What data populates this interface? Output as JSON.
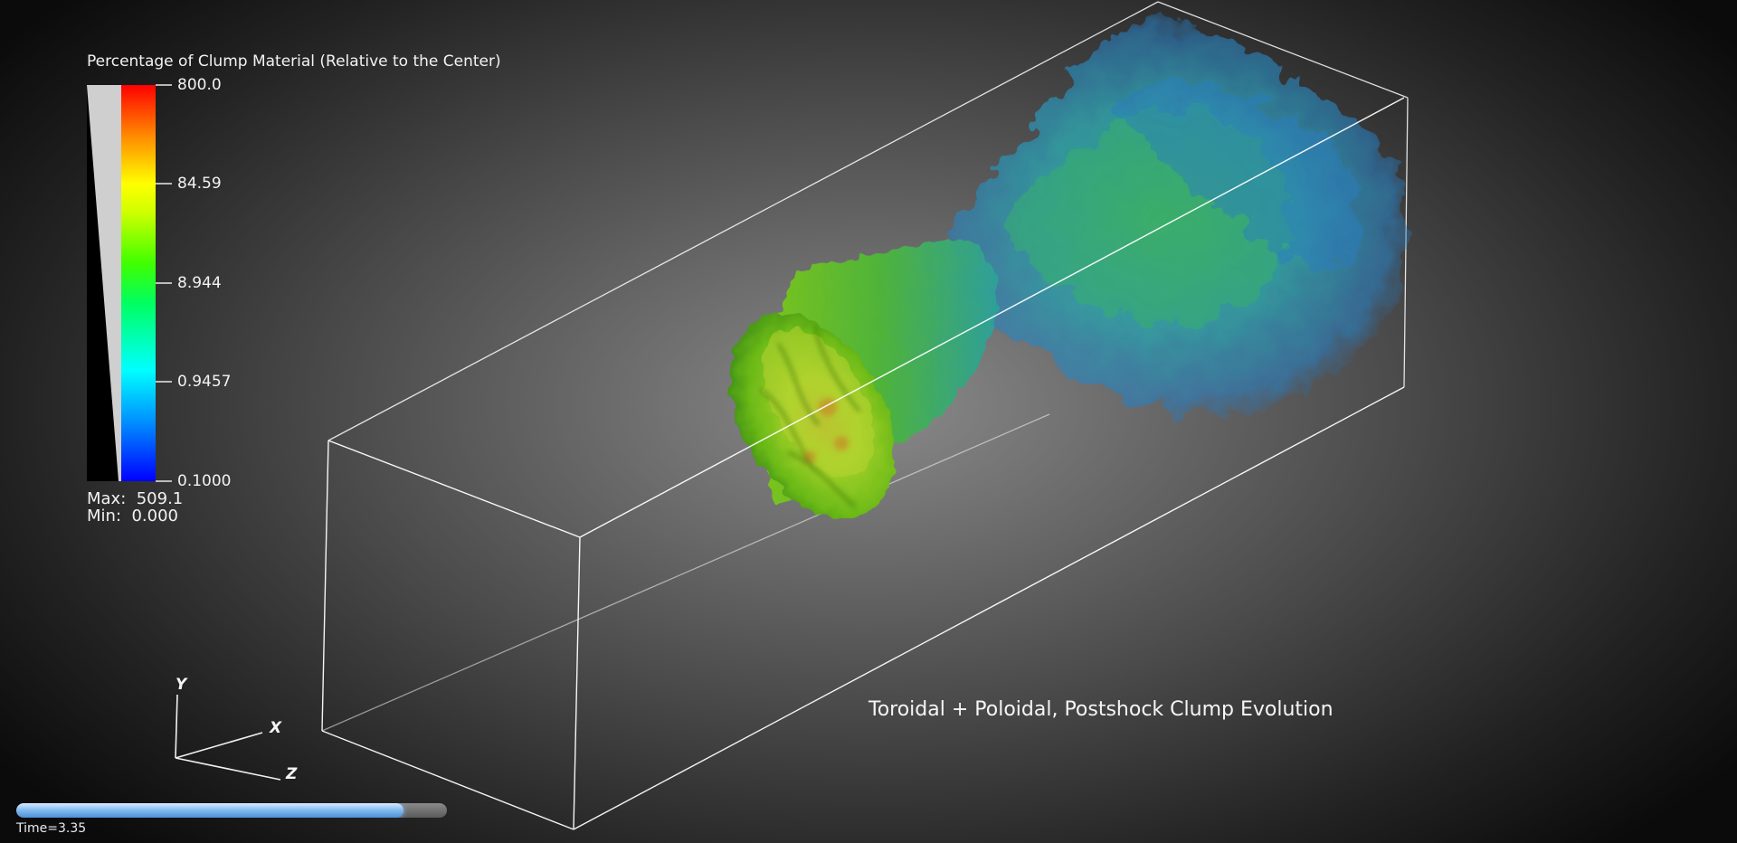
{
  "legend": {
    "title": "Percentage of Clump Material (Relative to the Center)",
    "ticks": [
      "800.0",
      "84.59",
      "8.944",
      "0.9457",
      "0.1000"
    ],
    "max_label": "Max:  509.1",
    "min_label": "Min:  0.000",
    "colormap": [
      "#0000ff",
      "#00b4ff",
      "#00ffff",
      "#00ff00",
      "#b0ff00",
      "#ffff00",
      "#ff9000",
      "#ff0000"
    ],
    "opacity_ramp_color": "#cccccc"
  },
  "axes": {
    "y": "Y",
    "x": "X",
    "z": "Z"
  },
  "caption": "Toroidal + Poloidal, Postshock Clump Evolution",
  "timeline": {
    "progress": 0.9,
    "time_label": "Time=3.35"
  },
  "volume": {
    "colors": {
      "head": "#8fd21a",
      "head_highlight": "#c8e23a",
      "tail": "#2ea7b0",
      "tail_blue": "#2b7fc2",
      "box_edge": "#ffffff"
    }
  }
}
